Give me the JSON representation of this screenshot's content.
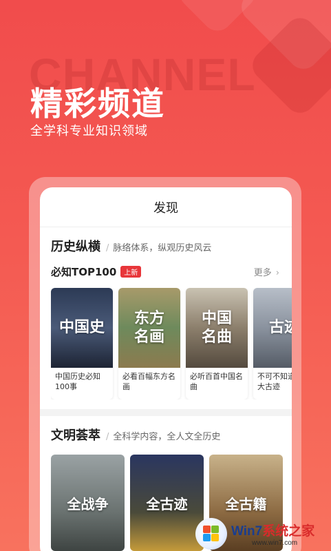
{
  "hero": {
    "bg_word": "CHANNEL",
    "title": "精彩频道",
    "subtitle": "全学科专业知识领域"
  },
  "app": {
    "nav_title": "发现",
    "section1": {
      "title": "历史纵横",
      "desc": "脉络体系，纵观历史风云",
      "sub_title": "必知TOP100",
      "badge": "上新",
      "more": "更多",
      "cards": [
        {
          "img_text": "中国史",
          "caption": "中国历史必知100事"
        },
        {
          "img_text": "东方\n名画",
          "caption": "必看百幅东方名画"
        },
        {
          "img_text": "中国\n名曲",
          "caption": "必听百首中国名曲"
        },
        {
          "img_text": "古迹",
          "caption": "不可不知道的百大古迹"
        }
      ]
    },
    "section2": {
      "title": "文明荟萃",
      "desc": "全科学内容，全人文全历史",
      "cards": [
        {
          "img_text": "全战争"
        },
        {
          "img_text": "全古迹"
        },
        {
          "img_text": "全古籍"
        }
      ]
    }
  },
  "watermark": {
    "brand_a": "Win7",
    "brand_b": "系统之家",
    "url": "www.win7.com"
  },
  "colors": {
    "background_top": "#f14c4c",
    "background_bottom": "#f8725e",
    "badge": "#e8363a"
  },
  "icons": [
    "chevron-right-icon",
    "windows-logo-icon"
  ]
}
